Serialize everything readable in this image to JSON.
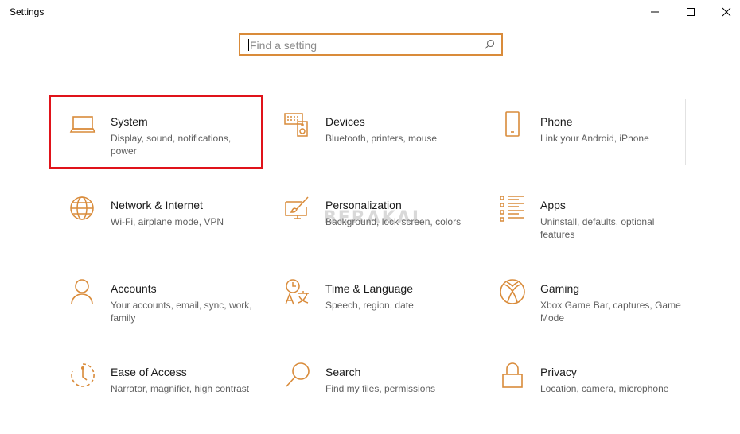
{
  "window": {
    "title": "Settings"
  },
  "search": {
    "placeholder": "Find a setting"
  },
  "watermark": "BERAKAL",
  "accent": "#d98b3a",
  "highlight_color": "#e0131a",
  "tiles": [
    {
      "icon": "laptop-icon",
      "name": "System",
      "desc": "Display, sound, notifications, power"
    },
    {
      "icon": "keyboard-speaker-icon",
      "name": "Devices",
      "desc": "Bluetooth, printers, mouse"
    },
    {
      "icon": "phone-icon",
      "name": "Phone",
      "desc": "Link your Android, iPhone"
    },
    {
      "icon": "globe-icon",
      "name": "Network & Internet",
      "desc": "Wi-Fi, airplane mode, VPN"
    },
    {
      "icon": "paintbrush-icon",
      "name": "Personalization",
      "desc": "Background, lock screen, colors"
    },
    {
      "icon": "apps-list-icon",
      "name": "Apps",
      "desc": "Uninstall, defaults, optional features"
    },
    {
      "icon": "person-icon",
      "name": "Accounts",
      "desc": "Your accounts, email, sync, work, family"
    },
    {
      "icon": "time-language-icon",
      "name": "Time & Language",
      "desc": "Speech, region, date"
    },
    {
      "icon": "xbox-icon",
      "name": "Gaming",
      "desc": "Xbox Game Bar, captures, Game Mode"
    },
    {
      "icon": "ease-of-access-icon",
      "name": "Ease of Access",
      "desc": "Narrator, magnifier, high contrast"
    },
    {
      "icon": "search-icon",
      "name": "Search",
      "desc": "Find my files, permissions"
    },
    {
      "icon": "lock-icon",
      "name": "Privacy",
      "desc": "Location, camera, microphone"
    }
  ]
}
